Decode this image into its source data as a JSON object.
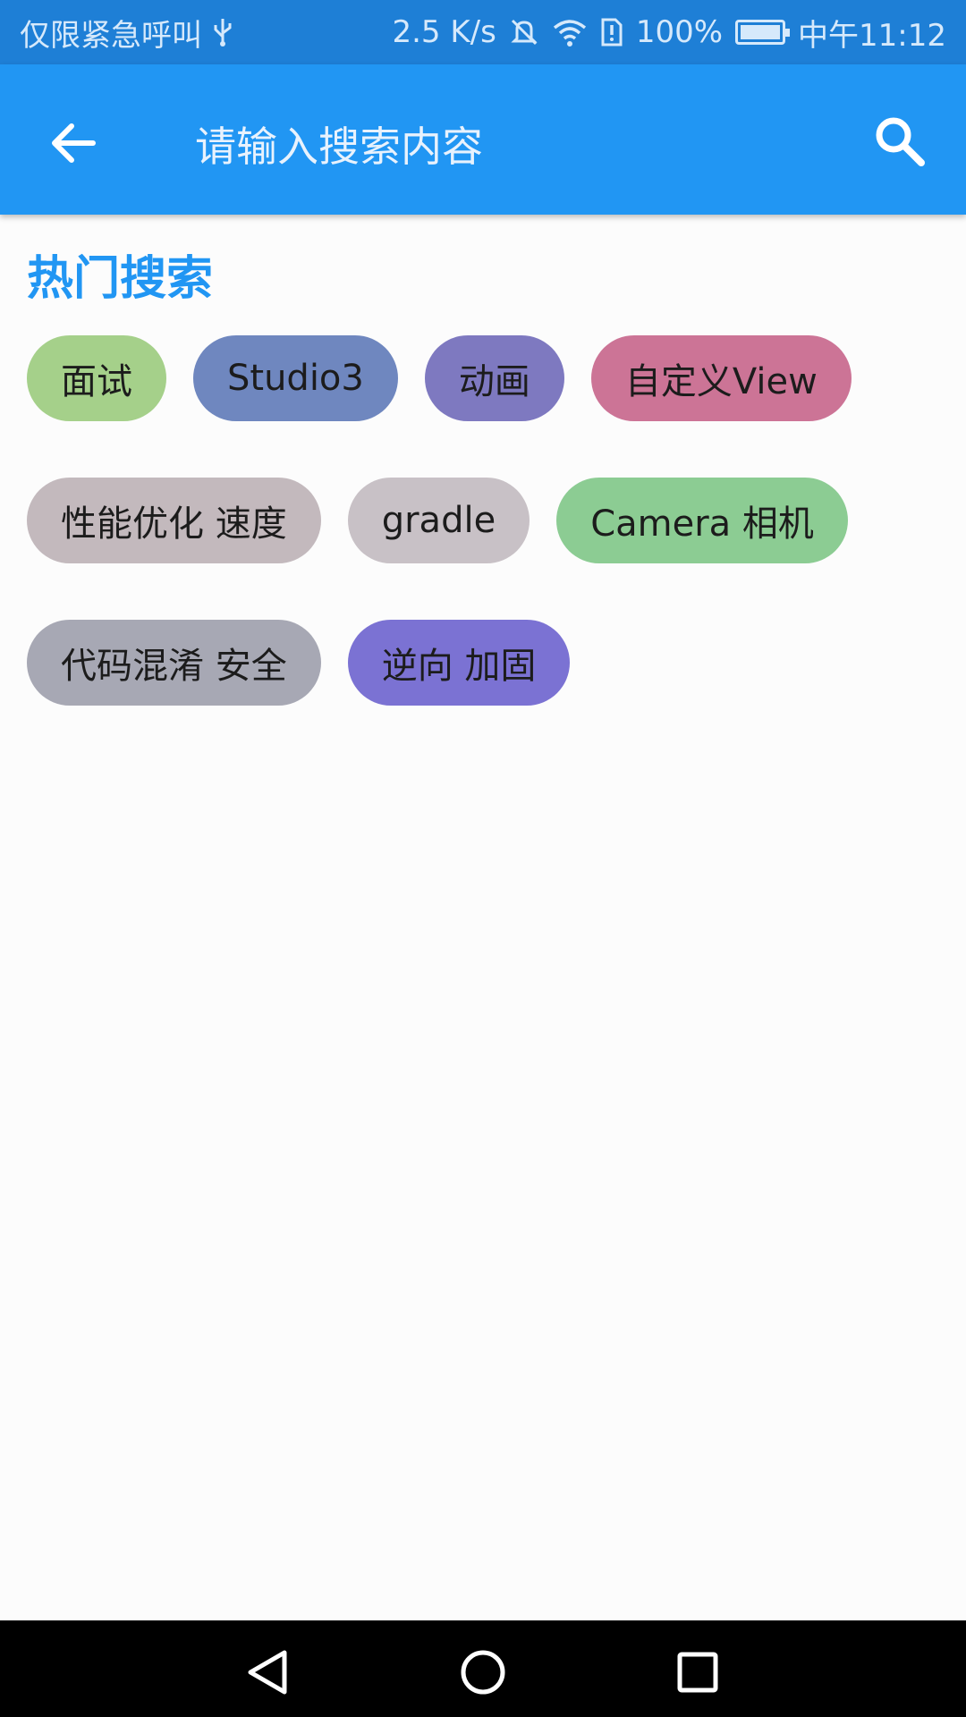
{
  "status_bar": {
    "carrier": "仅限紧急呼叫",
    "usb_icon": "usb-icon",
    "net_speed": "2.5 K/s",
    "mute_icon": "muted-bell-icon",
    "wifi_icon": "wifi-icon",
    "sim_icon": "sim-alert-icon",
    "battery_pct": "100%",
    "battery_icon": "battery-charging-icon",
    "time": "中午11:12",
    "bg_color": "#1e7fd6"
  },
  "app_bar": {
    "back_icon": "arrow-back-icon",
    "search_placeholder": "请输入搜索内容",
    "search_icon": "search-icon",
    "bg_color": "#2196f3"
  },
  "hot_search": {
    "title": "热门搜索",
    "title_color": "#2196f3",
    "rows": [
      [
        {
          "label": "面试",
          "color": "#a5d08a"
        },
        {
          "label": "Studio3",
          "color": "#6f87bf"
        },
        {
          "label": "动画",
          "color": "#7e79c0"
        },
        {
          "label": "自定义View",
          "color": "#cc7496"
        }
      ],
      [
        {
          "label": "性能优化 速度",
          "color": "#c3b9bd"
        },
        {
          "label": "gradle",
          "color": "#c8c1c6"
        },
        {
          "label": "Camera 相机",
          "color": "#8ccc93"
        }
      ],
      [
        {
          "label": "代码混淆 安全",
          "color": "#a7a8b4"
        },
        {
          "label": "逆向 加固",
          "color": "#7b72d3"
        }
      ]
    ]
  },
  "nav_bar": {
    "back_icon": "triangle-back-icon",
    "home_icon": "circle-home-icon",
    "recents_icon": "square-recents-icon"
  }
}
